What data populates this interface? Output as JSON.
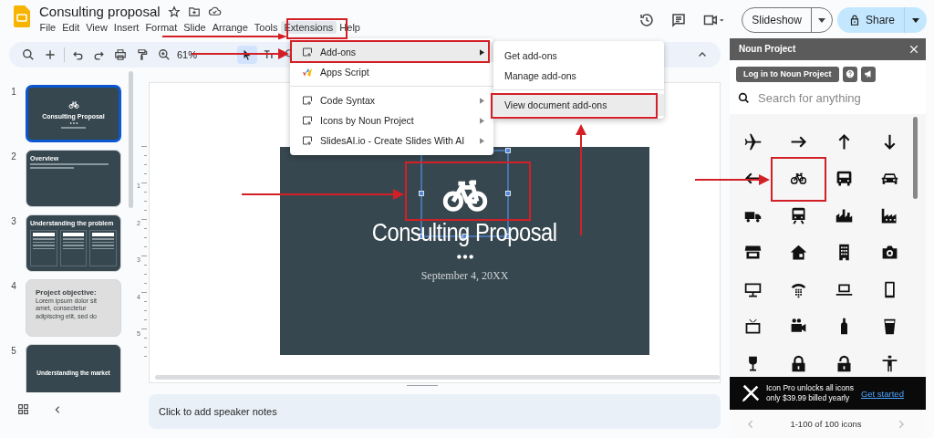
{
  "document": {
    "title": "Consulting proposal"
  },
  "menu": [
    {
      "label": "File",
      "selected": false
    },
    {
      "label": "Edit",
      "selected": false
    },
    {
      "label": "View",
      "selected": false
    },
    {
      "label": "Insert",
      "selected": false
    },
    {
      "label": "Format",
      "selected": false
    },
    {
      "label": "Slide",
      "selected": false
    },
    {
      "label": "Arrange",
      "selected": false
    },
    {
      "label": "Tools",
      "selected": false
    },
    {
      "label": "Extensions",
      "selected": true
    },
    {
      "label": "Help",
      "selected": false
    }
  ],
  "header": {
    "slideshow": "Slideshow",
    "share": "Share"
  },
  "toolbar": {
    "zoom": "61%"
  },
  "slides": [
    {
      "number": "1",
      "selected": true,
      "kind": "title",
      "title": "Consulting Proposal"
    },
    {
      "number": "2",
      "selected": false,
      "kind": "text",
      "title": "Overview"
    },
    {
      "number": "3",
      "selected": false,
      "kind": "columns",
      "title": "Understanding the problem"
    },
    {
      "number": "4",
      "selected": false,
      "kind": "objective",
      "title": "Project objective:",
      "body": "Lorem ipsum dolor sit amet, consectetur adipiscing elit, sed do"
    },
    {
      "number": "5",
      "selected": false,
      "kind": "section",
      "title": "Understanding the market"
    }
  ],
  "ruler": [
    "1",
    "2",
    "3",
    "4",
    "5"
  ],
  "slide": {
    "title": "Consulting Proposal",
    "date": "September 4, 20XX"
  },
  "extensions_menu": [
    [
      {
        "label": "Add-ons",
        "kind": "addon",
        "submenu": true,
        "selected": true
      },
      {
        "label": "Apps Script",
        "kind": "script",
        "submenu": false,
        "selected": false
      }
    ],
    [
      {
        "label": "Code Syntax",
        "kind": "addon",
        "submenu": true,
        "selected": false
      },
      {
        "label": "Icons by Noun Project",
        "kind": "addon",
        "submenu": true,
        "selected": false
      },
      {
        "label": "SlidesAI.io - Create Slides With AI",
        "kind": "addon",
        "submenu": true,
        "selected": false
      }
    ]
  ],
  "addons_submenu": [
    [
      {
        "label": "Get add-ons",
        "selected": false
      },
      {
        "label": "Manage add-ons",
        "selected": false
      }
    ],
    [
      {
        "label": "View document add-ons",
        "selected": true
      }
    ]
  ],
  "speaker_notes": {
    "placeholder": "Click to add speaker notes"
  },
  "noun_panel": {
    "title": "Noun Project",
    "login": "Log in to Noun Project",
    "search_placeholder": "Search for anything",
    "promo_line_1": "Icon Pro unlocks all icons",
    "promo_line_2": "only $39.99 billed yearly",
    "promo_link": "Get started",
    "pagination": "1-100 of 100 icons"
  }
}
